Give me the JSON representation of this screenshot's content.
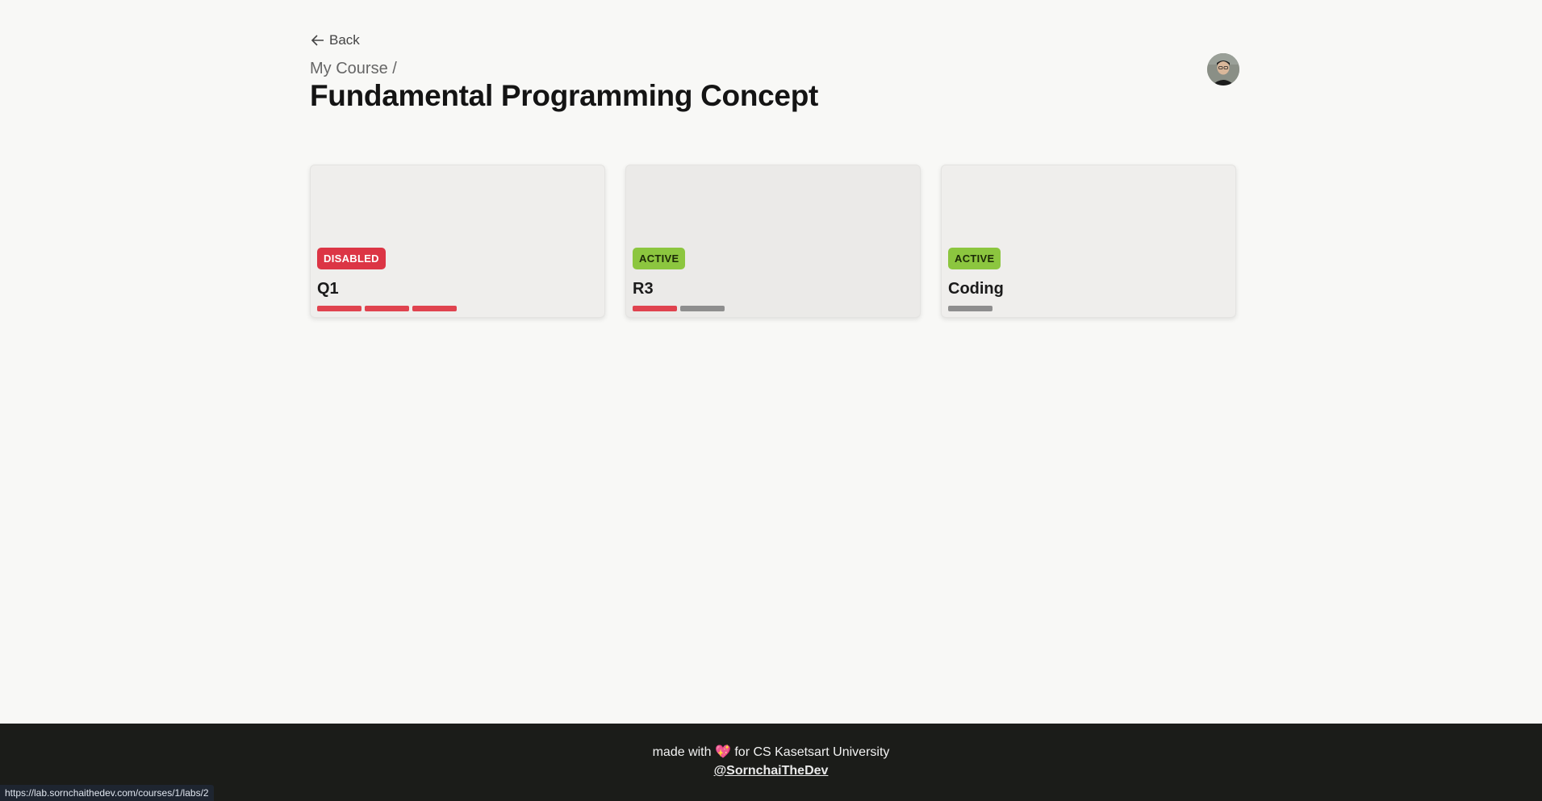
{
  "nav": {
    "back_label": "Back"
  },
  "header": {
    "breadcrumb": "My Course /",
    "title": "Fundamental Programming Concept"
  },
  "labs": [
    {
      "status": "DISABLED",
      "name": "Q1",
      "progress_colors": [
        "#e0434f",
        "#e0434f",
        "#e0434f"
      ]
    },
    {
      "status": "ACTIVE",
      "name": "R3",
      "progress_colors": [
        "#e0434f",
        "#8e8e8e"
      ]
    },
    {
      "status": "ACTIVE",
      "name": "Coding",
      "progress_colors": [
        "#8e8e8e"
      ]
    }
  ],
  "footer": {
    "made_prefix": "made with",
    "made_suffix": "for CS Kasetsart University",
    "heart_icon": "sparkling-heart-icon",
    "handle": "@SornchaiTheDev"
  },
  "status_url": "https://lab.sornchaithedev.com/courses/1/labs/2",
  "colors": {
    "disabled_badge": "#dc3545",
    "active_badge": "#8cc63f",
    "footer_bg": "#1b1c19",
    "page_bg": "#f8f8f6"
  }
}
